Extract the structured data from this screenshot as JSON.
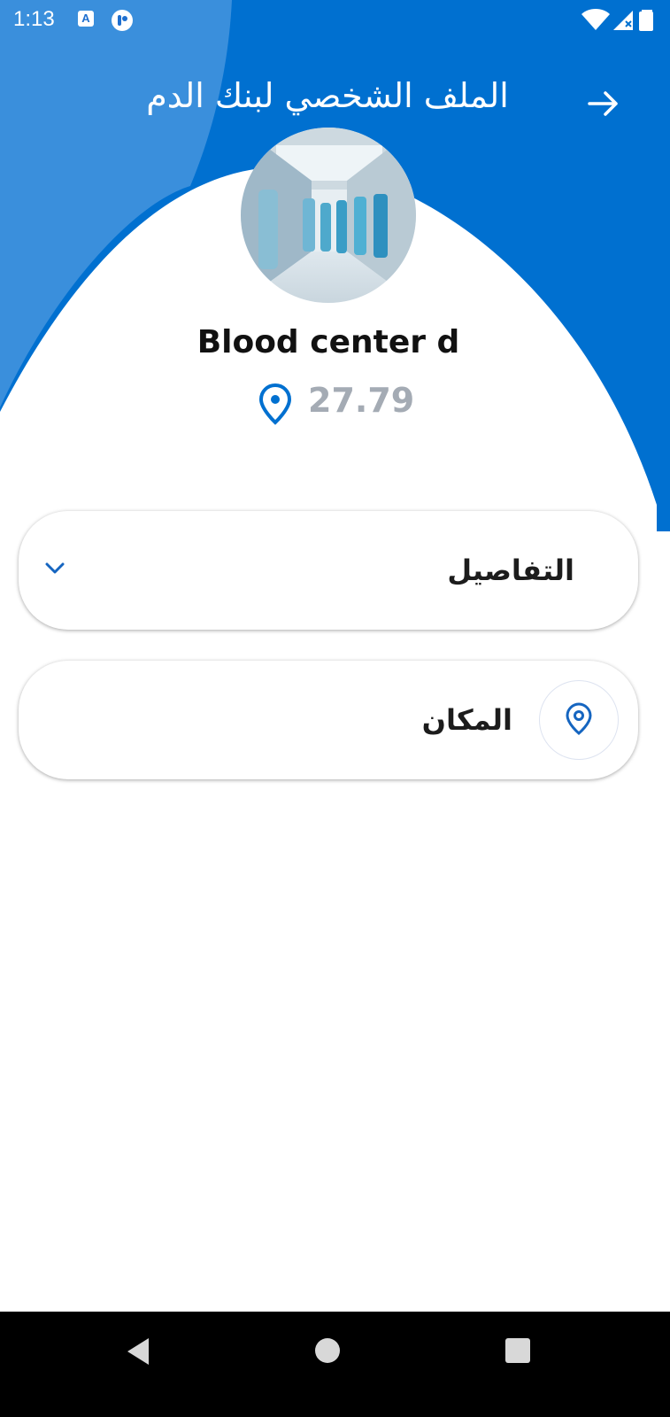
{
  "status_bar": {
    "time": "1:13",
    "notification_icon_1": "A"
  },
  "header": {
    "title": "الملف الشخصي لبنك الدم",
    "back_icon": "arrow-right-icon"
  },
  "profile": {
    "name": "Blood center d",
    "distance": "27.79",
    "avatar_description_icon": "hospital-corridor-photo"
  },
  "cards": {
    "details_label": "التفاصيل",
    "location_label": "المكان"
  },
  "colors": {
    "primary_blue": "#0070d0",
    "light_blue": "#3a8fdc",
    "distance_gray": "#a4abb4"
  }
}
